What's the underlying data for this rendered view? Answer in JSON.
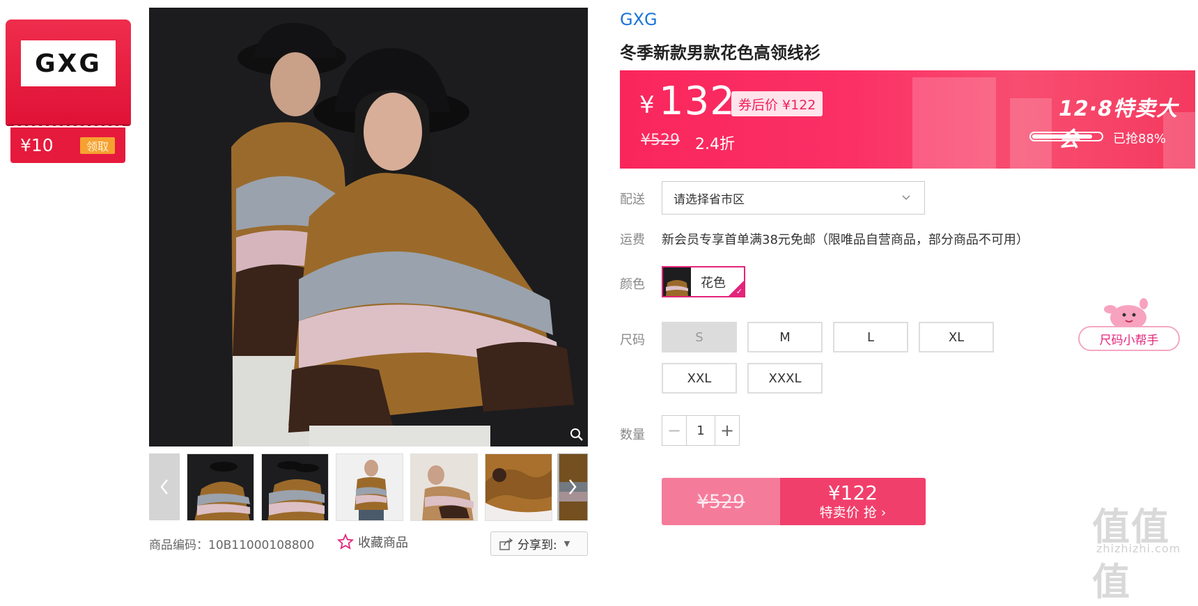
{
  "coupon": {
    "logo": "GXG",
    "amount": "¥10",
    "claim_label": "领取"
  },
  "gallery": {
    "zoom_icon": "magnifier-icon",
    "prev_icon": "chevron-left-icon",
    "next_icon": "chevron-right-icon",
    "thumbnail_count": 6
  },
  "meta": {
    "code_label": "商品编码：10B11000108800",
    "favorite_label": "收藏商品",
    "share_label": "分享到:"
  },
  "product": {
    "brand": "GXG",
    "title": "冬季新款男款花色高领线衫"
  },
  "price_banner": {
    "currency": "¥",
    "price": "132",
    "after_coupon": "券后价 ¥122",
    "original_price": "¥529",
    "discount": "2.4折",
    "event_name": "12·8特卖大会",
    "sold_text": "已抢88%",
    "sold_fraction": 0.88,
    "accent_color": "#f9265c"
  },
  "delivery": {
    "label": "配送",
    "placeholder": "请选择省市区"
  },
  "shipping": {
    "label": "运费",
    "text": "新会员专享首单满38元免邮（限唯品自营商品，部分商品不可用）"
  },
  "color": {
    "label": "颜色",
    "selected": "花色"
  },
  "size": {
    "label": "尺码",
    "options": [
      "S",
      "M",
      "L",
      "XL",
      "XXL",
      "XXXL"
    ],
    "helper_label": "尺码小帮手"
  },
  "quantity": {
    "label": "数量",
    "value": "1"
  },
  "buy": {
    "original_price": "¥529",
    "price": "¥122",
    "action_label": "特卖价 抢 ›"
  },
  "watermark": {
    "logo": "值值值",
    "url": "zhizhizhi.com"
  }
}
